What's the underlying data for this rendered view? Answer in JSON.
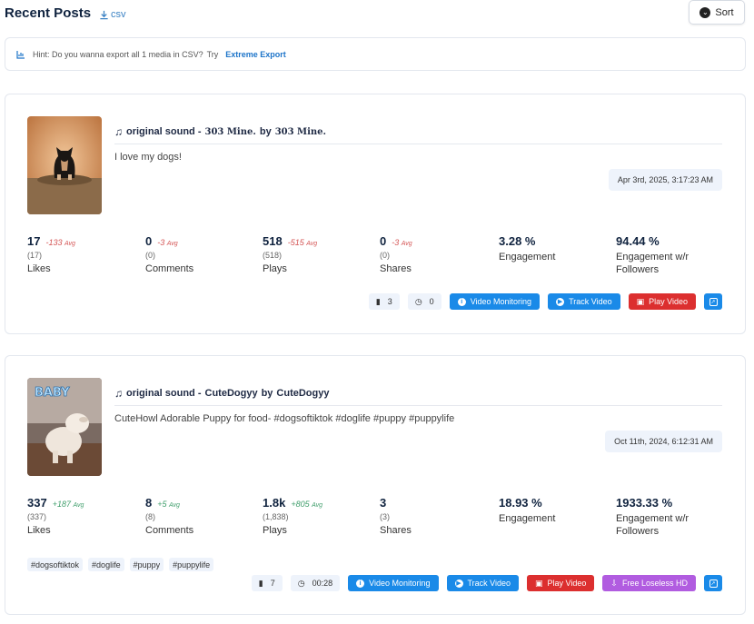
{
  "header": {
    "title": "Recent Posts",
    "csv_label": "csv",
    "sort_label": "Sort"
  },
  "hint": {
    "text": "Hint: Do you wanna export all 1 media in CSV?",
    "try": "Try",
    "link": "Extreme Export"
  },
  "posts": [
    {
      "sound_prefix": "original sound - ",
      "sound_name": "303 Mine.",
      "by": " by ",
      "author": "303 Mine.",
      "caption": "I love my dogs!",
      "date": "Apr 3rd, 2025, 3:17:23 AM",
      "stats": [
        {
          "value": "17",
          "avg": "-133",
          "avg_label": "Avg",
          "sub": "(17)",
          "label": "Likes"
        },
        {
          "value": "0",
          "avg": "-3",
          "avg_label": "Avg",
          "sub": "(0)",
          "label": "Comments"
        },
        {
          "value": "518",
          "avg": "-515",
          "avg_label": "Avg",
          "sub": "(518)",
          "label": "Plays"
        },
        {
          "value": "0",
          "avg": "-3",
          "avg_label": "Avg",
          "sub": "(0)",
          "label": "Shares"
        },
        {
          "value": "3.28 %",
          "label": "Engagement"
        },
        {
          "value": "94.44 %",
          "label": "Engagement w/r Followers"
        }
      ],
      "saves": "3",
      "duration": "0",
      "buttons": {
        "monitor": "Video Monitoring",
        "track": "Track Video",
        "play": "Play Video"
      }
    },
    {
      "sound_prefix": "original sound - ",
      "sound_name": "CuteDogyy",
      "by": " by ",
      "author": "CuteDogyy",
      "caption": "CuteHowl Adorable Puppy for food- #dogsoftiktok #doglife #puppy #puppylife",
      "date": "Oct 11th, 2024, 6:12:31 AM",
      "thumb_text": "BABY",
      "stats": [
        {
          "value": "337",
          "avg": "+187",
          "avg_label": "Avg",
          "sub": "(337)",
          "label": "Likes"
        },
        {
          "value": "8",
          "avg": "+5",
          "avg_label": "Avg",
          "sub": "(8)",
          "label": "Comments"
        },
        {
          "value": "1.8k",
          "avg": "+805",
          "avg_label": "Avg",
          "sub": "(1,838)",
          "label": "Plays"
        },
        {
          "value": "3",
          "sub": "(3)",
          "label": "Shares"
        },
        {
          "value": "18.93 %",
          "label": "Engagement"
        },
        {
          "value": "1933.33 %",
          "label": "Engagement w/r Followers"
        }
      ],
      "tags": [
        "#dogsoftiktok",
        "#doglife",
        "#puppy",
        "#puppylife"
      ],
      "saves": "7",
      "duration": "00:28",
      "buttons": {
        "monitor": "Video Monitoring",
        "track": "Track Video",
        "play": "Play Video",
        "hd": "Free Loseless HD"
      }
    }
  ],
  "colors": {
    "accent": "#1a8ae8",
    "play": "#dc2f2f",
    "hd": "#b15ce0",
    "negative": "#d45454",
    "positive": "#3f9e6b"
  }
}
